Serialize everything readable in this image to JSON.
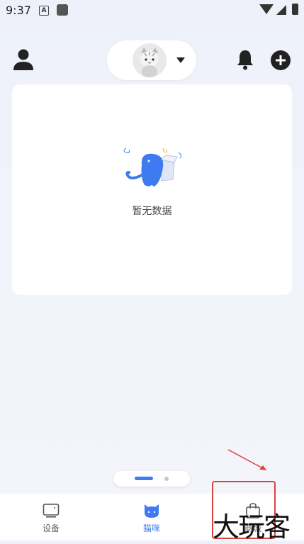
{
  "status_bar": {
    "time": "9:37",
    "notif_letter": "A"
  },
  "topbar": {
    "user_icon": "user-icon",
    "bell_icon": "bell-icon",
    "add_icon": "add-circle-icon"
  },
  "card": {
    "empty_text": "暂无数据"
  },
  "pager": {
    "pages": 2,
    "active_index": 0
  },
  "nav": {
    "items": [
      {
        "label": "设备",
        "icon": "device-icon",
        "active": false
      },
      {
        "label": "猫咪",
        "icon": "cat-icon",
        "active": true
      },
      {
        "label": "商城",
        "icon": "shopping-bag-icon",
        "active": false
      }
    ]
  },
  "overlay": {
    "watermark": "大玩客"
  },
  "colors": {
    "accent": "#3e7bf0",
    "annotation": "#d9443a"
  }
}
